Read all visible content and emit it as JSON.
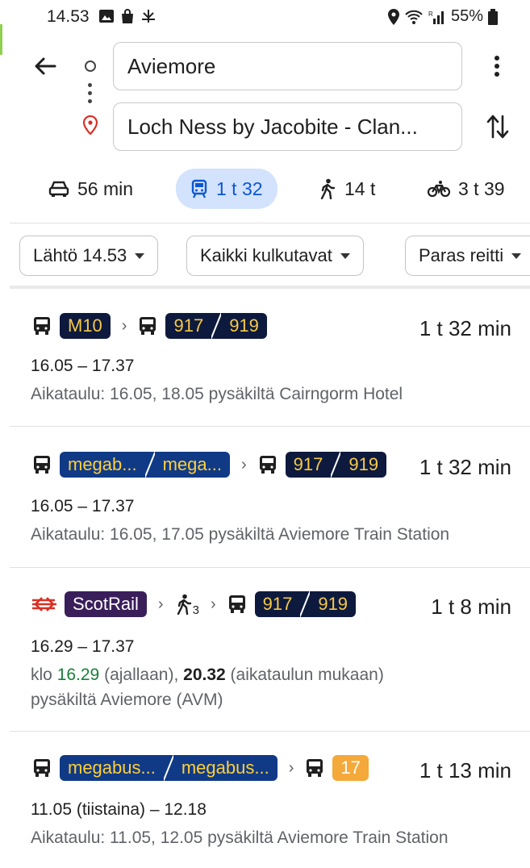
{
  "status_bar": {
    "time": "14.53",
    "battery": "55%"
  },
  "search": {
    "origin": "Aviemore",
    "destination": "Loch Ness by Jacobite - Clan..."
  },
  "modes": [
    {
      "label": "56 min",
      "icon": "car-icon"
    },
    {
      "label": "1 t 32",
      "icon": "train-icon",
      "active": true
    },
    {
      "label": "14 t",
      "icon": "walk-icon"
    },
    {
      "label": "3 t 39",
      "icon": "bike-icon"
    }
  ],
  "filters": {
    "depart": "Lähtö 14.53",
    "modes": "Kaikki kulkutavat",
    "route": "Paras reitti"
  },
  "routes": [
    {
      "segments": {
        "a": "M10",
        "b1": "917",
        "b2": "919"
      },
      "duration": "1 t  32 min",
      "times": "16.05 – 17.37",
      "info": "Aikataulu: 16.05, 18.05 pysäkiltä Cairngorm Hotel"
    },
    {
      "segments": {
        "a1": "megab...",
        "a2": "mega...",
        "b1": "917",
        "b2": "919"
      },
      "duration": "1 t  32 min",
      "times": "16.05 – 17.37",
      "info": "Aikataulu: 16.05, 17.05 pysäkiltä Aviemore Train Station"
    },
    {
      "segments": {
        "rail": "ScotRail",
        "walk": "3",
        "b1": "917",
        "b2": "919"
      },
      "duration": "1 t  8 min",
      "times": "16.29 – 17.37",
      "info_prefix": "klo ",
      "info_time1": "16.29",
      "info_mid": " (ajallaan), ",
      "info_time2": "20.32",
      "info_suffix": " (aikataulun mukaan)",
      "info_line2": "pysäkiltä Aviemore (AVM)"
    },
    {
      "segments": {
        "a1": "megabus...",
        "a2": "megabus...",
        "b": "17"
      },
      "duration": "1 t  13 min",
      "times": "11.05 (tiistaina) – 12.18",
      "info": "Aikataulu: 11.05, 12.05 pysäkiltä Aviemore Train Station"
    }
  ],
  "colors": {
    "accent": "#0b57d0",
    "active_bg": "#d3e3fd",
    "on_time": "#188038",
    "badge_dark": "#0e1a3d",
    "badge_text": "#f7c948"
  }
}
